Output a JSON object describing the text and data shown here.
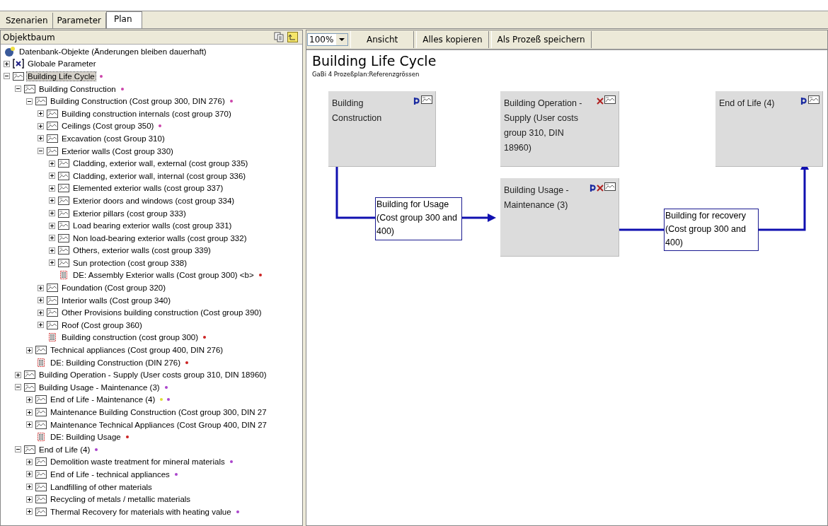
{
  "tabs": [
    {
      "label": "Szenarien",
      "selected": false
    },
    {
      "label": "Parameter",
      "selected": false
    },
    {
      "label": "Plan",
      "selected": true
    }
  ],
  "object_tree": {
    "title": "Objektbaum",
    "root": {
      "label": "Datenbank-Objekte (Änderungen bleiben dauerhaft)",
      "kind": "database"
    },
    "items": [
      {
        "label": "Globale Parameter",
        "kind": "parameter",
        "expanded": false
      },
      {
        "label": "Building Life Cycle",
        "kind": "plan",
        "expanded": true,
        "selected": true,
        "dots": [
          {
            "color": "#cc44aa"
          }
        ],
        "children": [
          {
            "label": "Building Construction",
            "kind": "plan",
            "expanded": true,
            "selected": false,
            "dots": [
              {
                "color": "#cc44aa"
              }
            ],
            "children": [
              {
                "label": "Building Construction (Cost group 300, DIN 276)",
                "kind": "plan",
                "expanded": true,
                "selected": false,
                "dots": [
                  {
                    "color": "#cc44aa"
                  }
                ],
                "children": [
                  {
                    "label": "Building construction internals (cost group 370)",
                    "kind": "plan",
                    "expanded": false,
                    "selected": false
                  },
                  {
                    "label": "Ceilings (Cost group 350)",
                    "kind": "plan",
                    "expanded": false,
                    "selected": false,
                    "dots": [
                      {
                        "color": "#cc44aa"
                      }
                    ]
                  },
                  {
                    "label": "Excavation (cost Group 310)",
                    "kind": "plan",
                    "expanded": false,
                    "selected": false
                  },
                  {
                    "label": "Exterior walls (Cost group 330)",
                    "kind": "plan",
                    "expanded": true,
                    "selected": false,
                    "children": [
                      {
                        "label": "Cladding, exterior wall, external (cost group 335)",
                        "kind": "plan",
                        "expanded": false,
                        "selected": false
                      },
                      {
                        "label": "Cladding, exterior wall, internal (cost group 336)",
                        "kind": "plan",
                        "expanded": false,
                        "selected": false
                      },
                      {
                        "label": "Elemented exterior walls (cost group 337)",
                        "kind": "plan",
                        "expanded": false,
                        "selected": false
                      },
                      {
                        "label": "Exterior doors and windows (cost group 334)",
                        "kind": "plan",
                        "expanded": false,
                        "selected": false
                      },
                      {
                        "label": "Exterior pillars (cost group 333)",
                        "kind": "plan",
                        "expanded": false,
                        "selected": false
                      },
                      {
                        "label": "Load bearing exterior walls (cost group 331)",
                        "kind": "plan",
                        "expanded": false,
                        "selected": false
                      },
                      {
                        "label": "Non load-bearing exterior walls (cost group 332)",
                        "kind": "plan",
                        "expanded": false,
                        "selected": false
                      },
                      {
                        "label": "Others, exterior walls (cost group 339)",
                        "kind": "plan",
                        "expanded": false,
                        "selected": false
                      },
                      {
                        "label": "Sun protection (cost group 338)",
                        "kind": "plan",
                        "expanded": false,
                        "selected": false
                      },
                      {
                        "label": "DE: Assembly Exterior walls (Cost group 300) <b>",
                        "kind": "process",
                        "selected": false,
                        "dots": [
                          {
                            "color": "#cc2222"
                          }
                        ]
                      }
                    ]
                  },
                  {
                    "label": "Foundation (Cost group 320)",
                    "kind": "plan",
                    "expanded": false,
                    "selected": false
                  },
                  {
                    "label": "Interior walls (Cost group 340)",
                    "kind": "plan",
                    "expanded": false,
                    "selected": false
                  },
                  {
                    "label": "Other Provisions building construction (Cost group 390)",
                    "kind": "plan",
                    "expanded": false,
                    "selected": false
                  },
                  {
                    "label": "Roof (Cost group 360)",
                    "kind": "plan",
                    "expanded": false,
                    "selected": false
                  },
                  {
                    "label": "Building construction (cost group 300)",
                    "kind": "process",
                    "selected": false,
                    "dots": [
                      {
                        "color": "#cc2222"
                      }
                    ]
                  }
                ]
              },
              {
                "label": "Technical appliances (Cost group 400, DIN 276)",
                "kind": "plan",
                "expanded": false,
                "selected": false
              },
              {
                "label": "DE: Building Construction (DIN 276)",
                "kind": "process",
                "selected": false,
                "dots": [
                  {
                    "color": "#cc2222"
                  }
                ]
              }
            ]
          },
          {
            "label": "Building Operation - Supply (User costs group 310, DIN 18960)",
            "kind": "plan",
            "expanded": false,
            "selected": false
          },
          {
            "label": "Building Usage - Maintenance (3)",
            "kind": "plan",
            "expanded": true,
            "selected": false,
            "dots": [
              {
                "color": "#aa44cc"
              }
            ],
            "children": [
              {
                "label": "End of Life - Maintenance (4)",
                "kind": "plan",
                "expanded": false,
                "selected": false,
                "dots": [
                  {
                    "color": "#dddd33"
                  },
                  {
                    "color": "#aa44cc"
                  }
                ]
              },
              {
                "label": "Maintenance Building Construction (Cost group 300, DIN 27",
                "kind": "plan",
                "expanded": false,
                "selected": false
              },
              {
                "label": "Maintenance Technical Appliances (Cost Group 400, DIN 27",
                "kind": "plan",
                "expanded": false,
                "selected": false
              },
              {
                "label": "DE: Building Usage",
                "kind": "process",
                "selected": false,
                "dots": [
                  {
                    "color": "#cc2222"
                  }
                ]
              }
            ]
          },
          {
            "label": "End of Life (4)",
            "kind": "plan",
            "expanded": true,
            "selected": false,
            "dots": [
              {
                "color": "#aa44cc"
              }
            ],
            "children": [
              {
                "label": "Demolition waste treatment for mineral materials",
                "kind": "plan",
                "expanded": false,
                "selected": false,
                "dots": [
                  {
                    "color": "#aa44cc"
                  }
                ]
              },
              {
                "label": "End of Life - technical appliances",
                "kind": "plan",
                "expanded": false,
                "selected": false,
                "dots": [
                  {
                    "color": "#aa44cc"
                  }
                ]
              },
              {
                "label": "Landfilling of other materials",
                "kind": "plan",
                "expanded": false,
                "selected": false
              },
              {
                "label": "Recycling of metals / metallic materials",
                "kind": "plan",
                "expanded": false,
                "selected": false
              },
              {
                "label": "Thermal Recovery for materials with heating value",
                "kind": "plan",
                "expanded": false,
                "selected": false,
                "dots": [
                  {
                    "color": "#aa44cc"
                  }
                ]
              }
            ]
          }
        ]
      }
    ]
  },
  "toolbar": {
    "zoom": "100%",
    "buttons": [
      "Ansicht",
      "Alles kopieren",
      "Als Prozeß speichern"
    ]
  },
  "plan": {
    "title": "Building Life Cycle",
    "subtitle": "GaBi 4 Prozeßplan:Referenzgrössen",
    "processes": [
      {
        "label": "Building Construction",
        "parameters": true,
        "excluded": false
      },
      {
        "label": "Building Operation - Supply (User costs group 310, DIN 18960)",
        "parameters": false,
        "excluded": true
      },
      {
        "label": "End of Life (4)",
        "parameters": true,
        "excluded": false
      },
      {
        "label": "Building Usage - Maintenance (3)",
        "parameters": true,
        "excluded": true
      }
    ],
    "flows": [
      {
        "label": "Building for Usage (Cost group 300 and 400)"
      },
      {
        "label": "Building for recovery (Cost group 300 and 400)"
      }
    ]
  }
}
